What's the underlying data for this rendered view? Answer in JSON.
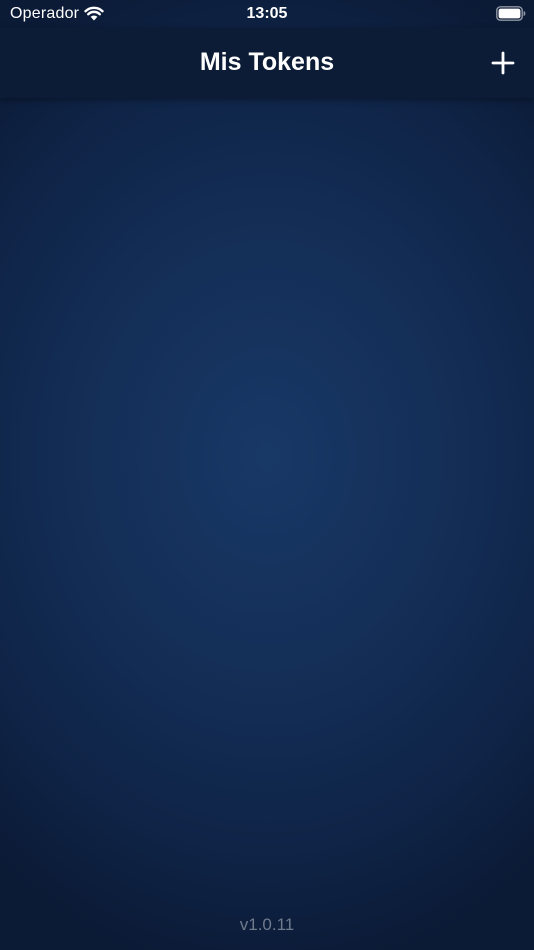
{
  "status_bar": {
    "carrier": "Operador",
    "time": "13:05",
    "wifi_icon": "wifi-icon",
    "battery_icon": "battery-icon"
  },
  "nav": {
    "title": "Mis Tokens",
    "add_icon": "plus-icon"
  },
  "footer": {
    "version": "v1.0.11"
  },
  "colors": {
    "background_center": "#183866",
    "background_edge": "#0b1a35",
    "nav_background": "#0c1b36",
    "text_primary": "#ffffff",
    "version_text": "#6f7a8d"
  }
}
